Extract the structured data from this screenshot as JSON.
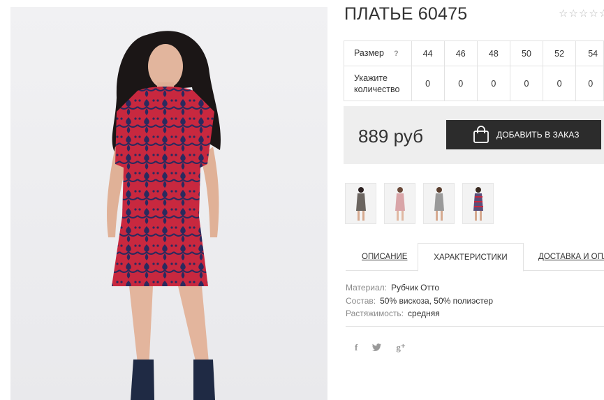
{
  "product": {
    "title": "ПЛАТЬЕ 60475",
    "rating_icon": "star-outline-icon",
    "rating_stars": 0,
    "rating_max": 5
  },
  "size_table": {
    "size_label": "Размер",
    "help_mark": "?",
    "sizes": [
      "44",
      "46",
      "48",
      "50",
      "52",
      "54"
    ],
    "qty_label": "Укажите количество",
    "quantities": [
      "0",
      "0",
      "0",
      "0",
      "0",
      "0"
    ]
  },
  "purchase": {
    "price": "889 руб",
    "order_button_label": "ДОБАВИТЬ В ЗАКАЗ",
    "order_icon": "shopping-bag-icon"
  },
  "thumbnails": [
    {
      "color": "#6b6560"
    },
    {
      "color": "#d9a5a8"
    },
    {
      "color": "#9a9a9a"
    },
    {
      "color": "#5a4f7a"
    }
  ],
  "tabs": [
    {
      "label": "ОПИСАНИЕ",
      "active": false
    },
    {
      "label": "ХАРАКТЕРИСТИКИ",
      "active": true
    },
    {
      "label": "ДОСТАВКА И ОПЛАТА",
      "active": false
    }
  ],
  "specs": [
    {
      "key": "Материал:",
      "value": "Рубчик Отто"
    },
    {
      "key": "Состав:",
      "value": "50% вискоза, 50% полиэстер"
    },
    {
      "key": "Растяжимость:",
      "value": "средняя"
    }
  ],
  "social": {
    "facebook": "f",
    "twitter": "twitter-bird-icon",
    "google_plus": "g⁺"
  },
  "colors": {
    "dress_red": "#c8283f",
    "dress_pattern": "#2a2a5e",
    "button_bg": "#2c2c2c",
    "panel_bg": "#eeeeee"
  }
}
